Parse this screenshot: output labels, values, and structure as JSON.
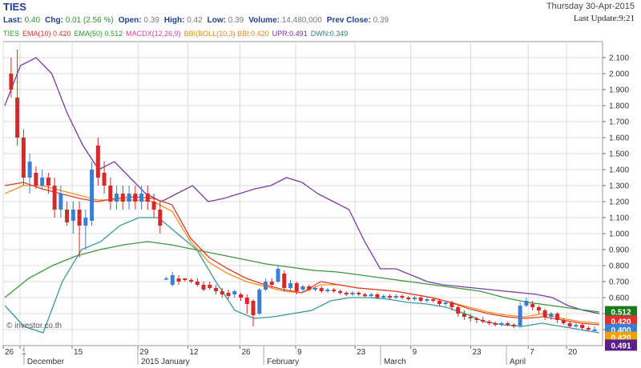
{
  "header": {
    "symbol": "TIES",
    "date": "Thursday  30-Apr-2015",
    "last_update": "Last Update:9:21",
    "stats": [
      {
        "label": "Last:",
        "value": "0.40",
        "kind": "chg"
      },
      {
        "label": "Chg:",
        "value": "0.01 (2.56 %)",
        "kind": "chg"
      },
      {
        "label": "Open:",
        "value": "0.39",
        "kind": "val"
      },
      {
        "label": "High:",
        "value": "0.42",
        "kind": "val"
      },
      {
        "label": "Low:",
        "value": "0.39",
        "kind": "val"
      },
      {
        "label": "Volume:",
        "value": "14,480,000",
        "kind": "val"
      },
      {
        "label": "Prev Close:",
        "value": "0.39",
        "kind": "val"
      }
    ]
  },
  "legend": [
    {
      "text": "TIES",
      "color": "#2a9a2a"
    },
    {
      "text": "EMA(10) 0.420",
      "color": "#e03030"
    },
    {
      "text": "EMA(50) 0.512",
      "color": "#2a9a2a"
    },
    {
      "text": "MACDX(12,26,9)",
      "color": "#e0409a"
    },
    {
      "text": "BBI(BOLL(10,3) BBI:0.420",
      "color": "#e08a10"
    },
    {
      "text": "UPR:0.491",
      "color": "#7a2aa0"
    },
    {
      "text": "DWN:0.349",
      "color": "#2a7a7a"
    }
  ],
  "watermark": "© investor.co.th",
  "colors": {
    "up": "#3a7fd5",
    "down": "#d42a2a",
    "ema10": "#e23a2a",
    "bbi": "#f09020",
    "ema50": "#3a9a3a",
    "upr": "#7a3aa0",
    "dwn": "#3a9a9a"
  },
  "chart_data": {
    "type": "candlestick",
    "ylim": [
      0.3,
      2.2
    ],
    "yticks": [
      0.4,
      0.5,
      0.6,
      0.7,
      0.8,
      0.9,
      1.0,
      1.1,
      1.2,
      1.3,
      1.4,
      1.5,
      1.6,
      1.7,
      1.8,
      1.9,
      2.0,
      2.1
    ],
    "ytick_labels": [
      "0.400",
      "0.500",
      "0.600",
      "0.700",
      "0.800",
      "0.900",
      "1.000",
      "1.100",
      "1.200",
      "1.300",
      "1.400",
      "1.500",
      "1.600",
      "1.700",
      "1.800",
      "1.900",
      "2.000",
      "2.100"
    ],
    "x_day_labels": [
      "26",
      "1",
      "15",
      "29",
      "12",
      "26",
      "9",
      "23",
      "9",
      "23",
      "7",
      "20"
    ],
    "x_month_labels": [
      "December",
      "2015 January",
      "February",
      "March",
      "April"
    ],
    "end_labels": [
      {
        "value": "0.512",
        "y": 0.512,
        "color": "#1f7a1f"
      },
      {
        "value": "0.420",
        "y": 0.453,
        "color": "#e03030"
      },
      {
        "value": "0.400",
        "y": 0.4,
        "color": "#3a7fd5"
      },
      {
        "value": "0.420",
        "y": 0.352,
        "color": "#f0a000"
      },
      {
        "value": "0.491",
        "y": 0.303,
        "color": "#5a1f8a"
      }
    ],
    "candles": [
      [
        2.0,
        1.9,
        2.1,
        1.85
      ],
      [
        1.85,
        1.6,
        2.15,
        1.55
      ],
      [
        1.6,
        1.35,
        1.65,
        1.3
      ],
      [
        1.35,
        1.45,
        1.5,
        1.25
      ],
      [
        1.38,
        1.3,
        1.42,
        1.28
      ],
      [
        1.3,
        1.35,
        1.4,
        1.28
      ],
      [
        1.35,
        1.3,
        1.38,
        1.25
      ],
      [
        1.3,
        1.15,
        1.35,
        1.1
      ],
      [
        1.15,
        1.25,
        1.3,
        1.1
      ],
      [
        1.15,
        1.07,
        1.2,
        1.05
      ],
      [
        1.08,
        1.15,
        1.2,
        1.0
      ],
      [
        1.15,
        1.05,
        1.2,
        0.85
      ],
      [
        1.05,
        1.1,
        1.15,
        0.9
      ],
      [
        1.08,
        1.4,
        1.45,
        1.05
      ],
      [
        1.55,
        1.35,
        1.6,
        1.3
      ],
      [
        1.38,
        1.3,
        1.45,
        1.25
      ],
      [
        1.3,
        1.2,
        1.35,
        1.15
      ],
      [
        1.2,
        1.25,
        1.3,
        1.15
      ],
      [
        1.25,
        1.2,
        1.3,
        1.15
      ],
      [
        1.2,
        1.25,
        1.3,
        1.15
      ],
      [
        1.25,
        1.2,
        1.3,
        1.15
      ],
      [
        1.2,
        1.25,
        1.3,
        1.15
      ],
      [
        1.25,
        1.2,
        1.3,
        1.15
      ],
      [
        1.2,
        1.15,
        1.25,
        1.1
      ],
      [
        1.15,
        1.05,
        1.2,
        1.0
      ],
      [
        0.72,
        0.72,
        0.73,
        0.71
      ],
      [
        0.68,
        0.74,
        0.76,
        0.67
      ],
      [
        0.72,
        0.7,
        0.74,
        0.68
      ],
      [
        0.72,
        0.71,
        0.72,
        0.7
      ],
      [
        0.71,
        0.7,
        0.72,
        0.69
      ],
      [
        0.7,
        0.68,
        0.72,
        0.67
      ],
      [
        0.68,
        0.65,
        0.7,
        0.64
      ],
      [
        0.68,
        0.66,
        0.7,
        0.65
      ],
      [
        0.66,
        0.64,
        0.68,
        0.62
      ],
      [
        0.64,
        0.62,
        0.66,
        0.6
      ],
      [
        0.63,
        0.61,
        0.65,
        0.59
      ],
      [
        0.62,
        0.64,
        0.65,
        0.6
      ],
      [
        0.62,
        0.6,
        0.63,
        0.58
      ],
      [
        0.6,
        0.56,
        0.62,
        0.5
      ],
      [
        0.58,
        0.49,
        0.59,
        0.42
      ],
      [
        0.5,
        0.65,
        0.66,
        0.49
      ],
      [
        0.65,
        0.7,
        0.72,
        0.64
      ],
      [
        0.7,
        0.68,
        0.72,
        0.66
      ],
      [
        0.7,
        0.78,
        0.8,
        0.69
      ],
      [
        0.75,
        0.66,
        0.77,
        0.64
      ],
      [
        0.66,
        0.69,
        0.71,
        0.64
      ],
      [
        0.69,
        0.64,
        0.7,
        0.62
      ],
      [
        0.65,
        0.67,
        0.68,
        0.63
      ],
      [
        0.67,
        0.65,
        0.68,
        0.64
      ],
      [
        0.65,
        0.66,
        0.67,
        0.64
      ],
      [
        0.66,
        0.64,
        0.67,
        0.63
      ],
      [
        0.64,
        0.65,
        0.66,
        0.63
      ],
      [
        0.65,
        0.64,
        0.66,
        0.63
      ],
      [
        0.64,
        0.63,
        0.65,
        0.62
      ],
      [
        0.63,
        0.62,
        0.64,
        0.61
      ],
      [
        0.62,
        0.63,
        0.64,
        0.61
      ],
      [
        0.63,
        0.62,
        0.64,
        0.61
      ],
      [
        0.62,
        0.61,
        0.63,
        0.6
      ],
      [
        0.61,
        0.62,
        0.63,
        0.6
      ],
      [
        0.62,
        0.6,
        0.63,
        0.59
      ],
      [
        0.6,
        0.61,
        0.62,
        0.59
      ],
      [
        0.61,
        0.6,
        0.62,
        0.59
      ],
      [
        0.6,
        0.61,
        0.62,
        0.59
      ],
      [
        0.61,
        0.6,
        0.62,
        0.59
      ],
      [
        0.6,
        0.59,
        0.61,
        0.58
      ],
      [
        0.59,
        0.6,
        0.61,
        0.58
      ],
      [
        0.6,
        0.58,
        0.61,
        0.57
      ],
      [
        0.58,
        0.59,
        0.6,
        0.57
      ],
      [
        0.59,
        0.58,
        0.6,
        0.57
      ],
      [
        0.58,
        0.56,
        0.59,
        0.55
      ],
      [
        0.56,
        0.57,
        0.58,
        0.55
      ],
      [
        0.57,
        0.54,
        0.58,
        0.52
      ],
      [
        0.54,
        0.5,
        0.55,
        0.48
      ],
      [
        0.5,
        0.48,
        0.52,
        0.46
      ],
      [
        0.48,
        0.47,
        0.5,
        0.45
      ],
      [
        0.47,
        0.46,
        0.48,
        0.44
      ],
      [
        0.46,
        0.45,
        0.48,
        0.44
      ],
      [
        0.45,
        0.44,
        0.46,
        0.43
      ],
      [
        0.44,
        0.43,
        0.45,
        0.42
      ],
      [
        0.43,
        0.44,
        0.45,
        0.42
      ],
      [
        0.44,
        0.43,
        0.45,
        0.42
      ],
      [
        0.43,
        0.42,
        0.44,
        0.41
      ],
      [
        0.42,
        0.55,
        0.57,
        0.41
      ],
      [
        0.55,
        0.58,
        0.6,
        0.54
      ],
      [
        0.56,
        0.54,
        0.58,
        0.52
      ],
      [
        0.54,
        0.52,
        0.55,
        0.5
      ],
      [
        0.52,
        0.48,
        0.53,
        0.46
      ],
      [
        0.48,
        0.5,
        0.51,
        0.46
      ],
      [
        0.5,
        0.46,
        0.51,
        0.44
      ],
      [
        0.46,
        0.44,
        0.47,
        0.43
      ],
      [
        0.44,
        0.42,
        0.45,
        0.41
      ],
      [
        0.42,
        0.43,
        0.44,
        0.41
      ],
      [
        0.43,
        0.41,
        0.44,
        0.4
      ],
      [
        0.41,
        0.4,
        0.42,
        0.39
      ],
      [
        0.39,
        0.4,
        0.42,
        0.39
      ]
    ],
    "upr": [
      1.8,
      2.05,
      2.1,
      2.0,
      1.75,
      1.55,
      1.4,
      1.45,
      1.35,
      1.25,
      1.2,
      1.25,
      1.3,
      1.2,
      1.22,
      1.25,
      1.28,
      1.3,
      1.35,
      1.32,
      1.25,
      1.2,
      1.15,
      0.95,
      0.78,
      0.78,
      0.74,
      0.7,
      0.68,
      0.67,
      0.66,
      0.65,
      0.64,
      0.63,
      0.62,
      0.6,
      0.55,
      0.52,
      0.5
    ],
    "ema10": [
      1.3,
      1.32,
      1.28,
      1.25,
      1.22,
      1.2,
      1.22,
      1.23,
      1.22,
      1.18,
      0.97,
      0.85,
      0.78,
      0.72,
      0.68,
      0.65,
      0.63,
      0.7,
      0.68,
      0.66,
      0.65,
      0.64,
      0.62,
      0.6,
      0.57,
      0.53,
      0.5,
      0.48,
      0.47,
      0.48,
      0.46,
      0.44,
      0.43
    ],
    "bbi": [
      1.25,
      1.3,
      1.3,
      1.27,
      1.24,
      1.21,
      1.21,
      1.21,
      1.2,
      1.14,
      0.95,
      0.82,
      0.75,
      0.7,
      0.67,
      0.64,
      0.63,
      0.68,
      0.68,
      0.66,
      0.65,
      0.64,
      0.62,
      0.6,
      0.57,
      0.54,
      0.51,
      0.49,
      0.48,
      0.5,
      0.47,
      0.45,
      0.44
    ],
    "ema50": [
      0.6,
      0.72,
      0.8,
      0.86,
      0.9,
      0.93,
      0.95,
      0.93,
      0.9,
      0.87,
      0.84,
      0.81,
      0.79,
      0.77,
      0.76,
      0.74,
      0.72,
      0.7,
      0.68,
      0.66,
      0.64,
      0.6,
      0.57,
      0.55,
      0.53,
      0.51
    ],
    "dwn": [
      0.55,
      0.42,
      0.38,
      0.7,
      0.9,
      0.95,
      1.05,
      1.1,
      1.1,
      1.0,
      0.9,
      0.7,
      0.52,
      0.47,
      0.48,
      0.5,
      0.52,
      0.58,
      0.6,
      0.6,
      0.59,
      0.57,
      0.56,
      0.54,
      0.5,
      0.45,
      0.43,
      0.42,
      0.44,
      0.42,
      0.4,
      0.38
    ]
  }
}
